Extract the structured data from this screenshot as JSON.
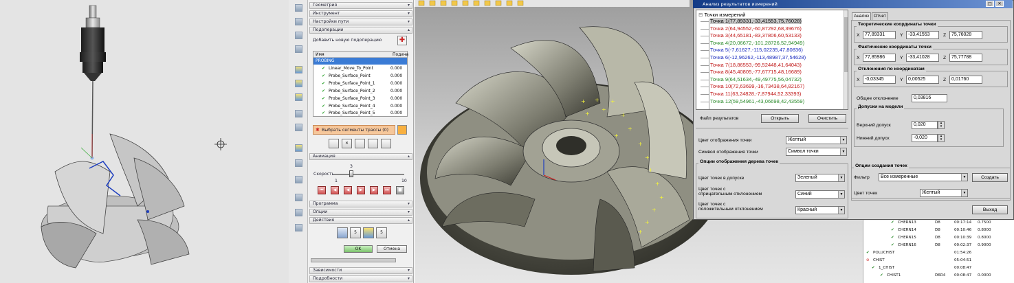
{
  "left_panel": {
    "sections_top": [
      "Геометрия",
      "Инструмент",
      "Настройки пути",
      "Подоперации"
    ],
    "add_subop": "Добавить новую подоперацию",
    "list_headers": [
      "Имя",
      "Подача"
    ],
    "list_group": "PROBING",
    "list_rows": [
      {
        "name": "Linear_Move_To_Point",
        "value": "0.000"
      },
      {
        "name": "Probe_Surface_Point",
        "value": "0.000"
      },
      {
        "name": "Probe_Surface_Point_1",
        "value": "0.000"
      },
      {
        "name": "Probe_Surface_Point_2",
        "value": "0.000"
      },
      {
        "name": "Probe_Surface_Point_3",
        "value": "0.000"
      },
      {
        "name": "Probe_Surface_Point_4",
        "value": "0.000"
      },
      {
        "name": "Probe_Surface_Point_5",
        "value": "0.000"
      }
    ],
    "select_segments": "Выбрать сегменты трассы (0)",
    "animation": "Анимация",
    "speed_label": "Скорость",
    "speed_value": "3",
    "speed_min": "1",
    "speed_max": "10",
    "sections_bottom": [
      "Программа",
      "Опции",
      "Действия"
    ],
    "ok": "OK",
    "cancel": "Отмена",
    "sections_end": [
      "Зависимости",
      "Подробности"
    ]
  },
  "dialog": {
    "title": "Анализ результатов измерений",
    "tree_root": "Точки измерений",
    "points": [
      {
        "text": "Точка 1(77,89331,-33,41553,75,76028)",
        "color": "#000000"
      },
      {
        "text": "Точка 2(64,94552,-60,87292,68,39676)",
        "color": "#c01818"
      },
      {
        "text": "Точка 3(44,65181,-83,37806,60,53133)",
        "color": "#c01818"
      },
      {
        "text": "Точка 4(20,06672,-101,28726,52,94949)",
        "color": "#2a8a2a"
      },
      {
        "text": "Точка 5(-7,61627,-115,02235,47,80836)",
        "color": "#1a2bbf"
      },
      {
        "text": "Точка 6(-12,96262,-113,48987,37,54628)",
        "color": "#1a2bbf"
      },
      {
        "text": "Точка 7(18,86553,-99,52448,41,64043)",
        "color": "#c01818"
      },
      {
        "text": "Точка 8(45,40805,-77,67715,48,16689)",
        "color": "#c01818"
      },
      {
        "text": "Точка 9(64,51634,-49,49775,56,04732)",
        "color": "#2a8a2a"
      },
      {
        "text": "Точка 10(72,63699,-16,73438,64,82167)",
        "color": "#c01818"
      },
      {
        "text": "Точка 11(63,24828,-7,87944,52,33393)",
        "color": "#c01818"
      },
      {
        "text": "Точка 12(59,54961,-43,06698,42,43559)",
        "color": "#2a8a2a"
      }
    ],
    "tabs": [
      "Анализ",
      "Отчет"
    ],
    "theor_label": "Теоретические координаты точки",
    "theor": {
      "x": "77,89331",
      "y": "-33,41553",
      "z": "75,76028"
    },
    "fact_label": "Фактические координаты точки",
    "fact": {
      "x": "77,85986",
      "y": "-33,41028",
      "z": "75,77788"
    },
    "dev_label": "Отклонения по координатам",
    "dev": {
      "x": "-0,03345",
      "y": "0,00525",
      "z": "0,01760"
    },
    "total_dev_label": "Общее отклонение",
    "total_dev": "0,03816",
    "tol_label": "Допуски на модели",
    "upper_tol_label": "Верхний допуск",
    "upper_tol": "0,020",
    "lower_tol_label": "Нижний допуск",
    "lower_tol": "-0,020",
    "result_file_label": "Файл результатов",
    "open": "Открыть",
    "clear": "Очистить",
    "display_color_label": "Цвет отображения точки",
    "display_color": "Желтый",
    "display_symbol_label": "Символ отображения точки",
    "display_symbol": "Символ точки",
    "tree_opts_label": "Опции отображения дерева точек",
    "in_tol_label": "Цвет точек в допуске",
    "in_tol": "Зеленый",
    "neg_dev_label1": "Цвет точек с",
    "neg_dev_label2": "отрицательным отклонением",
    "neg_dev": "Синий",
    "pos_dev_label1": "Цвет точек с",
    "pos_dev_label2": "положительным отклонением",
    "pos_dev": "Красный",
    "create_opts_label": "Опции создания точек",
    "filter_label": "Фильтр",
    "filter": "Все измеренные",
    "create": "Создать",
    "points_color_label": "Цвет точек",
    "points_color": "Желтый",
    "exit": "Выход"
  },
  "right_table": {
    "rows": [
      {
        "name": "CHERN13",
        "tool": "D8",
        "time": "00:17:14",
        "val": "0.7500"
      },
      {
        "name": "CHERN14",
        "tool": "D8",
        "time": "00:10:46",
        "val": "0.8000"
      },
      {
        "name": "CHERN15",
        "tool": "D8",
        "time": "00:10:39",
        "val": "0.8000"
      },
      {
        "name": "CHERN16",
        "tool": "D8",
        "time": "00:02:37",
        "val": "0.9000"
      },
      {
        "name": "POLUCHIST",
        "tool": "",
        "time": "01:54:26",
        "val": ""
      },
      {
        "name": "CHIST",
        "tool": "",
        "time": "05:04:51",
        "val": ""
      },
      {
        "name": "1_CHIST",
        "tool": "",
        "time": "00:08:47",
        "val": ""
      },
      {
        "name": "CHIST1",
        "tool": "D6R4",
        "time": "00:08:47",
        "val": "0.0000"
      }
    ]
  },
  "colors": {
    "highlight": "#3a7bd5",
    "title_bar": "#123b86",
    "point_marker": "#f2f23a"
  }
}
